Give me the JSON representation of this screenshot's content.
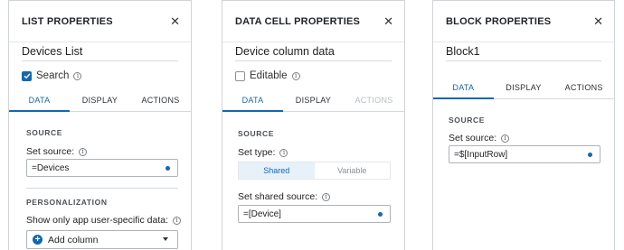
{
  "list_panel": {
    "title": "LIST PROPERTIES",
    "name_value": "Devices List",
    "search_label": "Search",
    "search_checked": true,
    "tabs": [
      "DATA",
      "DISPLAY",
      "ACTIONS"
    ],
    "source_heading": "SOURCE",
    "set_source_label": "Set source:",
    "source_value": "=Devices",
    "personalization_heading": "PERSONALIZATION",
    "show_only_label": "Show only app user-specific data:",
    "add_column_label": "Add column"
  },
  "cell_panel": {
    "title": "DATA CELL PROPERTIES",
    "name_value": "Device column data",
    "editable_label": "Editable",
    "editable_checked": false,
    "tabs": [
      "DATA",
      "DISPLAY",
      "ACTIONS"
    ],
    "source_heading": "SOURCE",
    "set_type_label": "Set type:",
    "type_options": [
      "Shared",
      "Variable"
    ],
    "shared_source_label": "Set shared source:",
    "shared_source_value": "=[Device]"
  },
  "block_panel": {
    "title": "BLOCK PROPERTIES",
    "name_value": "Block1",
    "tabs": [
      "DATA",
      "DISPLAY",
      "ACTIONS"
    ],
    "source_heading": "SOURCE",
    "set_source_label": "Set source:",
    "source_value": "=$[InputRow]"
  },
  "icons": {
    "close": "close-icon",
    "info": "info-icon",
    "check": "checkmark-icon",
    "plus": "plus-circle-icon",
    "caret": "chevron-down-icon"
  },
  "colors": {
    "accent": "#1467b0"
  }
}
